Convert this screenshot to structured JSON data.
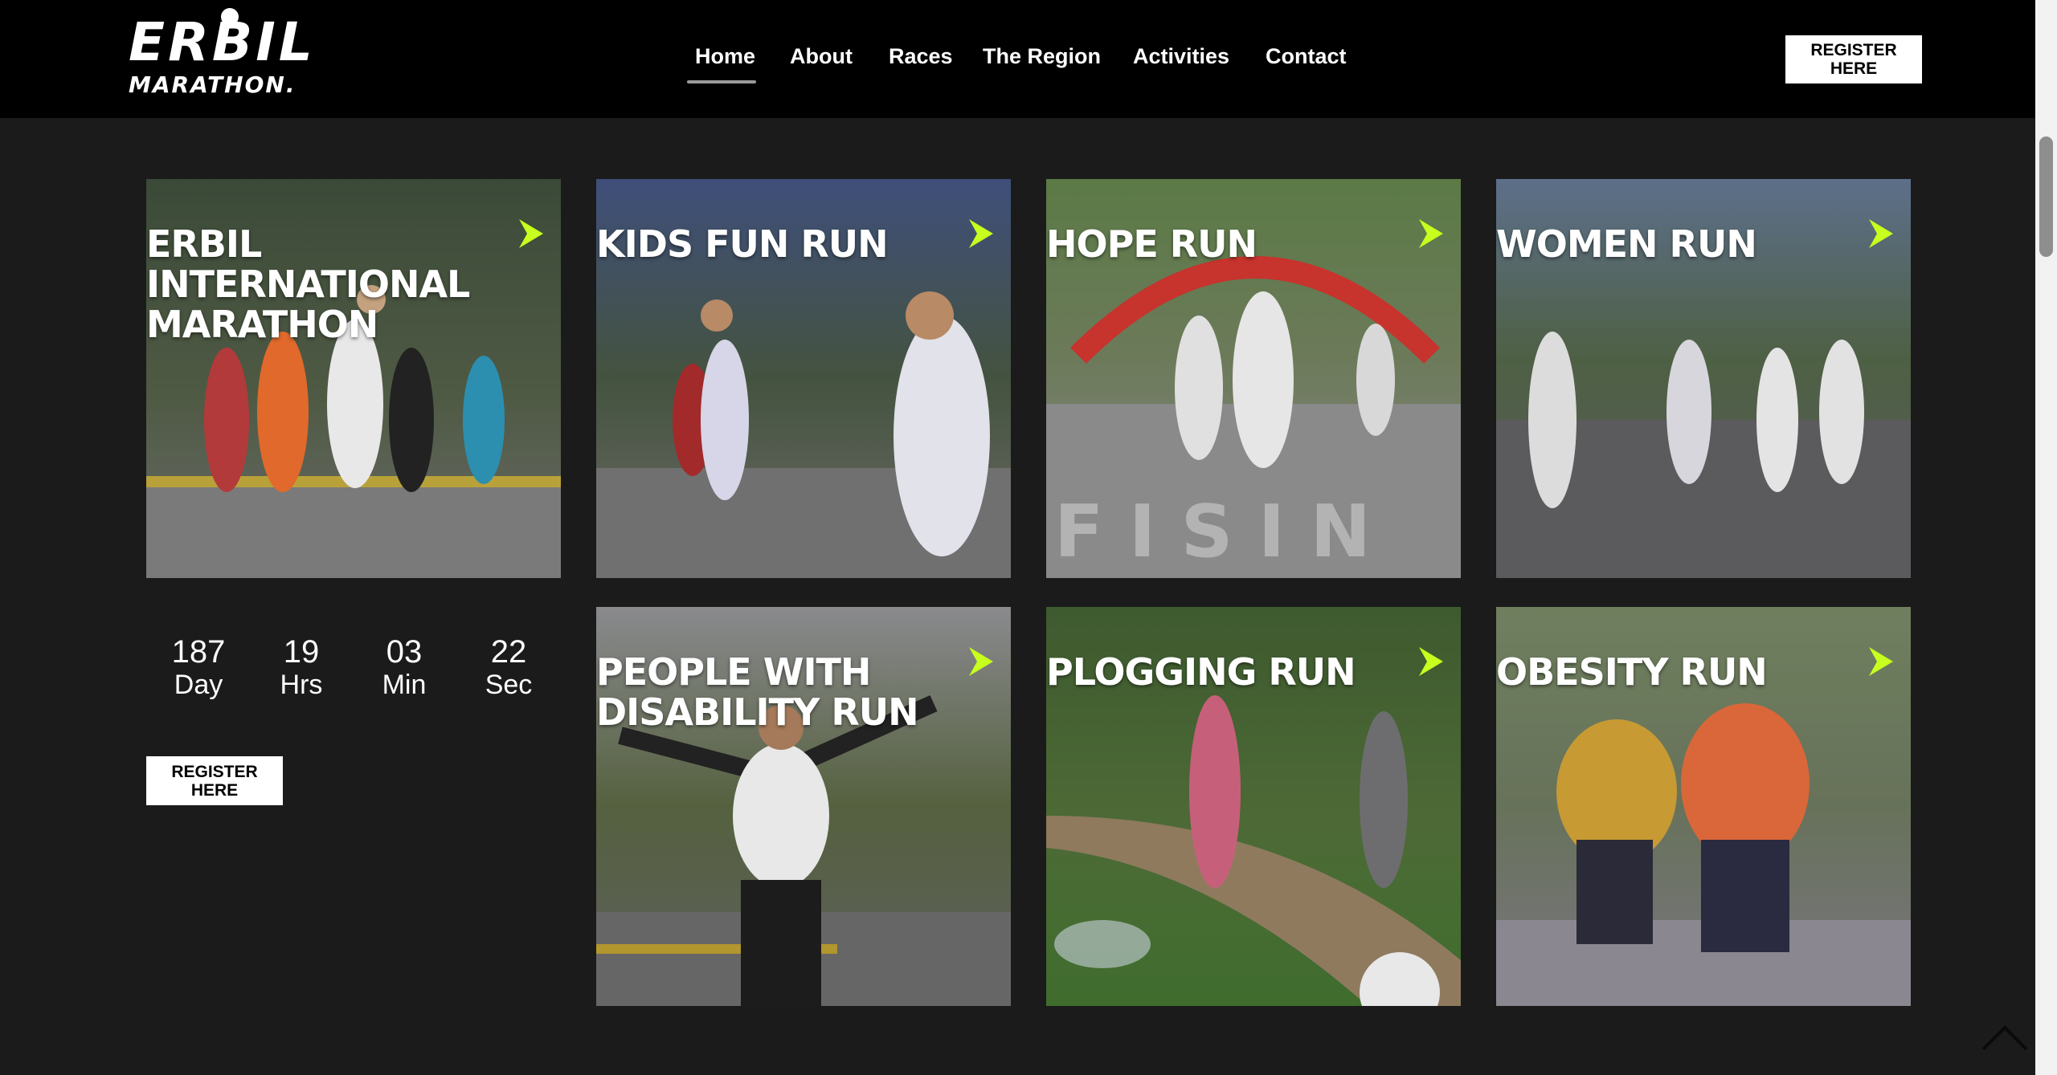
{
  "brand": {
    "logo_main": "ERBIL",
    "logo_sub": "MARATHON."
  },
  "nav": {
    "items": [
      {
        "label": "Home",
        "active": true
      },
      {
        "label": "About"
      },
      {
        "label": "Races"
      },
      {
        "label": "The Region"
      },
      {
        "label": "Activities"
      },
      {
        "label": "Contact"
      }
    ]
  },
  "header": {
    "register_label": "REGISTER HERE"
  },
  "races": [
    {
      "title": "ERBIL INTERNATIONAL MARATHON",
      "arrow_icon": "chevron-right-icon"
    },
    {
      "title": "KIDS FUN RUN",
      "arrow_icon": "chevron-right-icon"
    },
    {
      "title": "HOPE RUN",
      "arrow_icon": "chevron-right-icon"
    },
    {
      "title": "WOMEN RUN",
      "arrow_icon": "chevron-right-icon"
    },
    {
      "title": "PEOPLE WITH DISABILITY RUN",
      "arrow_icon": "chevron-right-icon"
    },
    {
      "title": "PLOGGING RUN",
      "arrow_icon": "chevron-right-icon"
    },
    {
      "title": "OBESITY RUN",
      "arrow_icon": "chevron-right-icon"
    }
  ],
  "countdown": {
    "day": {
      "value": "187",
      "unit": "Day"
    },
    "hrs": {
      "value": "19",
      "unit": "Hrs"
    },
    "min": {
      "value": "03",
      "unit": "Min"
    },
    "sec": {
      "value": "22",
      "unit": "Sec"
    }
  },
  "sidebar": {
    "register_label": "REGISTER HERE"
  },
  "colors": {
    "accent": "#c8ff1e",
    "header_bg": "#000000",
    "page_bg": "#1b1b1b"
  }
}
